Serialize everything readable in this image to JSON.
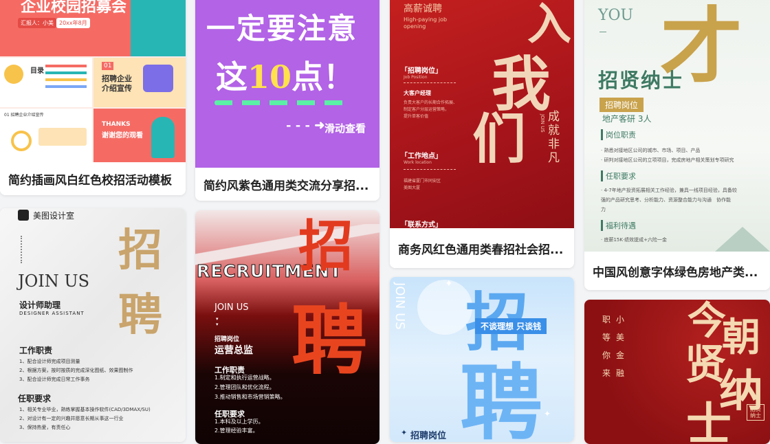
{
  "cards": [
    {
      "title": "简约插画风白红色校招活动模板",
      "poster": {
        "headline": "企业校园招募会",
        "reporter": "汇报人：小美",
        "date": "20xx年8月",
        "toc": "目录",
        "section_no": "01",
        "section_title_line1": "招聘企业",
        "section_title_line2": "介绍宣传",
        "intro": "01 招聘企业介绍宣传",
        "thanks_line1": "THANKS",
        "thanks_line2": "谢谢您的观看"
      }
    },
    {
      "title": "简约风紫色通用类交流分享招...",
      "poster": {
        "line1": "一定要注意",
        "line2_pre": "这",
        "line2_num": "10",
        "line2_post": "点！",
        "swipe": "滑动查看"
      }
    },
    {
      "title": "商务风红色通用类春招社会招...",
      "poster": {
        "salary": "高薪诚聘",
        "salary_en": "High-paying job opening",
        "big1": "入",
        "big2": "我",
        "big3": "们",
        "side1": "成就非凡",
        "side_en": "JOIN US",
        "position_label": "「招聘岗位」",
        "position_en": "Job Position",
        "job_title": "大客户经理",
        "job_desc1": "负责大客户的长期合作拓展、",
        "job_desc2": "制定客户分层运营策略，",
        "job_desc3": "提升单客价值",
        "work_label": "「工作地点」",
        "work_en": "Work location",
        "work_addr1": "福建省厦门市同安区",
        "work_addr2": "美图大厦",
        "contact_label": "「联系方式」"
      }
    },
    {
      "title": "中国风创意字体绿色房地产类...",
      "poster": {
        "you": "YOU",
        "headline": "招贤纳士",
        "position_tag": "招聘岗位",
        "position_value": "地产客研 3人",
        "duty_label": "岗位职责",
        "duty1": "· 熟悉对接地区公司的城市、市场、项目、产品",
        "duty2": "· 研判对接地区公司的立项项目，完成房地产相关策划专项研究",
        "req_label": "任职要求",
        "req1": "· 4-7年地产投资拓展相关工作经验，兼具一线项目经验，具备较",
        "req2": "强的产品研究思考、分析能力、资源整合能力与沟通　协作能",
        "req3": "力",
        "benefit_label": "福利待遇",
        "benefit1": "· 底薪15K·绩效提成+六险一金"
      }
    },
    {
      "title": "",
      "poster": {
        "studio": "美图设计室",
        "joinus": "JOIN US",
        "role": "设计师助理",
        "role_en": "DESIGNER ASSISTANT",
        "big1": "招",
        "big2": "聘",
        "duty_label": "工作职责",
        "duty1": "1、配合设计师完成项目测量",
        "duty2": "2、根据方案，按时按质的完成深化图纸、效果图制作",
        "duty3": "3、配合设计师完成日常工作事务",
        "req_label": "任职要求",
        "req1": "1、相关专业毕业，熟练掌握基本操作软件(CAD/3DMAX/SU)",
        "req2": "2、对设计有一定的兴趣并愿意长期从事这一行业",
        "req3": "3、保持热爱，有责任心"
      }
    },
    {
      "title": "",
      "poster": {
        "recruit_en": "RECRUITMENT",
        "big1": "招",
        "big2": "聘",
        "joinus": "JOIN US",
        "position_label": "招聘岗位",
        "position": "运营总监",
        "duty_label": "工作职责",
        "duty1": "1.制定和执行运营战略。",
        "duty2": "2.管理团队和优化流程。",
        "duty3": "3.推动销售和市场营销策略。",
        "req_label": "任职要求",
        "req1": "1.本科及以上学历。",
        "req2": "2.管理经验丰富。"
      }
    },
    {
      "title": "",
      "poster": {
        "side_en": "JOIN US",
        "big1": "招",
        "big2": "聘",
        "slogan": "不谈理想 只谈钱",
        "position_label": "招聘岗位"
      }
    },
    {
      "title": "",
      "poster": {
        "col1": "小美",
        "col2": "职等你来",
        "col3": "金融",
        "big1": "今",
        "big2": "朝",
        "big3": "贤",
        "big4": "纳",
        "big5": "士",
        "seal": "招贤纳士"
      }
    }
  ]
}
